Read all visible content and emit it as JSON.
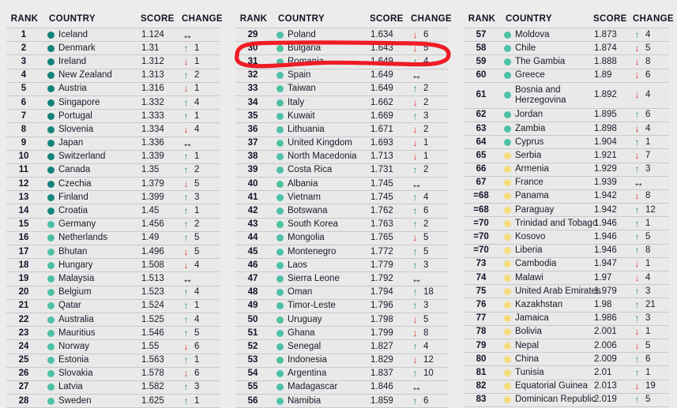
{
  "table": {
    "headers": {
      "rank": "RANK",
      "country": "COUNTRY",
      "score": "SCORE",
      "change": "CHANGE"
    },
    "colors": {
      "dot_dark_teal": "#14837a",
      "dot_teal": "#2fae96",
      "dot_light_teal": "#5ec6ad",
      "dot_yellow": "#f5dd7e",
      "arrow_up": "#2c8f6e",
      "arrow_down": "#e03127",
      "arrow_same": "#15151f",
      "annotation_red": "#ee1c25",
      "row_background": "#e9e9e9",
      "page_background": "#ececec"
    },
    "glyphs": {
      "up": "↑",
      "down": "↓",
      "same": "↔"
    },
    "columns": [
      {
        "id": "column-1",
        "rows": [
          {
            "rank": "1",
            "country": "Iceland",
            "score": "1.124",
            "dir": "same",
            "delta": "",
            "dot": "#14837a"
          },
          {
            "rank": "2",
            "country": "Denmark",
            "score": "1.31",
            "dir": "up",
            "delta": "1",
            "dot": "#14837a"
          },
          {
            "rank": "3",
            "country": "Ireland",
            "score": "1.312",
            "dir": "down",
            "delta": "1",
            "dot": "#14837a"
          },
          {
            "rank": "4",
            "country": "New Zealand",
            "score": "1.313",
            "dir": "up",
            "delta": "2",
            "dot": "#14837a"
          },
          {
            "rank": "5",
            "country": "Austria",
            "score": "1.316",
            "dir": "down",
            "delta": "1",
            "dot": "#14837a"
          },
          {
            "rank": "6",
            "country": "Singapore",
            "score": "1.332",
            "dir": "up",
            "delta": "4",
            "dot": "#14837a"
          },
          {
            "rank": "7",
            "country": "Portugal",
            "score": "1.333",
            "dir": "up",
            "delta": "1",
            "dot": "#14837a"
          },
          {
            "rank": "8",
            "country": "Slovenia",
            "score": "1.334",
            "dir": "down",
            "delta": "4",
            "dot": "#14837a"
          },
          {
            "rank": "9",
            "country": "Japan",
            "score": "1.336",
            "dir": "same",
            "delta": "",
            "dot": "#14837a"
          },
          {
            "rank": "10",
            "country": "Switzerland",
            "score": "1.339",
            "dir": "up",
            "delta": "1",
            "dot": "#14837a"
          },
          {
            "rank": "11",
            "country": "Canada",
            "score": "1.35",
            "dir": "up",
            "delta": "2",
            "dot": "#14837a"
          },
          {
            "rank": "12",
            "country": "Czechia",
            "score": "1.379",
            "dir": "down",
            "delta": "5",
            "dot": "#14837a"
          },
          {
            "rank": "13",
            "country": "Finland",
            "score": "1.399",
            "dir": "up",
            "delta": "3",
            "dot": "#16867c"
          },
          {
            "rank": "14",
            "country": "Croatia",
            "score": "1.45",
            "dir": "up",
            "delta": "1",
            "dot": "#17887d"
          },
          {
            "rank": "15",
            "country": "Germany",
            "score": "1.456",
            "dir": "up",
            "delta": "2",
            "dot": "#49bfa5"
          },
          {
            "rank": "16",
            "country": "Netherlands",
            "score": "1.49",
            "dir": "up",
            "delta": "5",
            "dot": "#4cc0a6"
          },
          {
            "rank": "17",
            "country": "Bhutan",
            "score": "1.496",
            "dir": "down",
            "delta": "5",
            "dot": "#4dc1a7"
          },
          {
            "rank": "18",
            "country": "Hungary",
            "score": "1.508",
            "dir": "down",
            "delta": "4",
            "dot": "#4dc1a7"
          },
          {
            "rank": "19",
            "country": "Malaysia",
            "score": "1.513",
            "dir": "same",
            "delta": "",
            "dot": "#4dc1a7"
          },
          {
            "rank": "20",
            "country": "Belgium",
            "score": "1.523",
            "dir": "up",
            "delta": "4",
            "dot": "#4dc1a7"
          },
          {
            "rank": "21",
            "country": "Qatar",
            "score": "1.524",
            "dir": "up",
            "delta": "1",
            "dot": "#4dc1a7"
          },
          {
            "rank": "22",
            "country": "Australia",
            "score": "1.525",
            "dir": "up",
            "delta": "4",
            "dot": "#4dc1a7"
          },
          {
            "rank": "23",
            "country": "Mauritius",
            "score": "1.546",
            "dir": "up",
            "delta": "5",
            "dot": "#4dc1a7"
          },
          {
            "rank": "24",
            "country": "Norway",
            "score": "1.55",
            "dir": "down",
            "delta": "6",
            "dot": "#4dc1a7"
          },
          {
            "rank": "25",
            "country": "Estonia",
            "score": "1.563",
            "dir": "up",
            "delta": "1",
            "dot": "#4dc1a7"
          },
          {
            "rank": "26",
            "country": "Slovakia",
            "score": "1.578",
            "dir": "down",
            "delta": "6",
            "dot": "#4dc1a7"
          },
          {
            "rank": "27",
            "country": "Latvia",
            "score": "1.582",
            "dir": "up",
            "delta": "3",
            "dot": "#4dc1a7"
          },
          {
            "rank": "28",
            "country": "Sweden",
            "score": "1.625",
            "dir": "up",
            "delta": "1",
            "dot": "#4dc1a7"
          }
        ]
      },
      {
        "id": "column-2",
        "rows": [
          {
            "rank": "29",
            "country": "Poland",
            "score": "1.634",
            "dir": "down",
            "delta": "6",
            "dot": "#4dc1a7"
          },
          {
            "rank": "30",
            "country": "Bulgaria",
            "score": "1.643",
            "dir": "down",
            "delta": "5",
            "dot": "#4dc1a7",
            "highlighted": true
          },
          {
            "rank": "31",
            "country": "Romania",
            "score": "1.649",
            "dir": "up",
            "delta": "4",
            "dot": "#4dc1a7"
          },
          {
            "rank": "32",
            "country": "Spain",
            "score": "1.649",
            "dir": "same",
            "delta": "",
            "dot": "#4dc1a7"
          },
          {
            "rank": "33",
            "country": "Taiwan",
            "score": "1.649",
            "dir": "up",
            "delta": "2",
            "dot": "#4dc1a7"
          },
          {
            "rank": "34",
            "country": "Italy",
            "score": "1.662",
            "dir": "down",
            "delta": "2",
            "dot": "#4dc1a7"
          },
          {
            "rank": "35",
            "country": "Kuwait",
            "score": "1.669",
            "dir": "up",
            "delta": "3",
            "dot": "#4dc1a7"
          },
          {
            "rank": "36",
            "country": "Lithuania",
            "score": "1.671",
            "dir": "down",
            "delta": "2",
            "dot": "#4dc1a7"
          },
          {
            "rank": "37",
            "country": "United Kingdom",
            "score": "1.693",
            "dir": "down",
            "delta": "1",
            "dot": "#4dc1a7"
          },
          {
            "rank": "38",
            "country": "North Macedonia",
            "score": "1.713",
            "dir": "down",
            "delta": "1",
            "dot": "#4dc1a7"
          },
          {
            "rank": "39",
            "country": "Costa Rica",
            "score": "1.731",
            "dir": "up",
            "delta": "2",
            "dot": "#4dc1a7"
          },
          {
            "rank": "40",
            "country": "Albania",
            "score": "1.745",
            "dir": "same",
            "delta": "",
            "dot": "#4dc1a7"
          },
          {
            "rank": "41",
            "country": "Vietnam",
            "score": "1.745",
            "dir": "up",
            "delta": "4",
            "dot": "#4dc1a7"
          },
          {
            "rank": "42",
            "country": "Botswana",
            "score": "1.762",
            "dir": "up",
            "delta": "6",
            "dot": "#4dc1a7"
          },
          {
            "rank": "43",
            "country": "South Korea",
            "score": "1.763",
            "dir": "up",
            "delta": "2",
            "dot": "#4dc1a7"
          },
          {
            "rank": "44",
            "country": "Mongolia",
            "score": "1.765",
            "dir": "down",
            "delta": "5",
            "dot": "#4dc1a7"
          },
          {
            "rank": "45",
            "country": "Montenegro",
            "score": "1.772",
            "dir": "up",
            "delta": "5",
            "dot": "#4dc1a7"
          },
          {
            "rank": "46",
            "country": "Laos",
            "score": "1.779",
            "dir": "up",
            "delta": "3",
            "dot": "#4dc1a7"
          },
          {
            "rank": "47",
            "country": "Sierra Leone",
            "score": "1.792",
            "dir": "same",
            "delta": "",
            "dot": "#4dc1a7"
          },
          {
            "rank": "48",
            "country": "Oman",
            "score": "1.794",
            "dir": "up",
            "delta": "18",
            "dot": "#4dc1a7"
          },
          {
            "rank": "49",
            "country": "Timor-Leste",
            "score": "1.796",
            "dir": "up",
            "delta": "3",
            "dot": "#4dc1a7"
          },
          {
            "rank": "50",
            "country": "Uruguay",
            "score": "1.798",
            "dir": "down",
            "delta": "5",
            "dot": "#4dc1a7"
          },
          {
            "rank": "51",
            "country": "Ghana",
            "score": "1.799",
            "dir": "down",
            "delta": "8",
            "dot": "#4dc1a7"
          },
          {
            "rank": "52",
            "country": "Senegal",
            "score": "1.827",
            "dir": "up",
            "delta": "4",
            "dot": "#4dc1a7"
          },
          {
            "rank": "53",
            "country": "Indonesia",
            "score": "1.829",
            "dir": "down",
            "delta": "12",
            "dot": "#4dc1a7"
          },
          {
            "rank": "54",
            "country": "Argentina",
            "score": "1.837",
            "dir": "up",
            "delta": "10",
            "dot": "#4dc1a7"
          },
          {
            "rank": "55",
            "country": "Madagascar",
            "score": "1.846",
            "dir": "same",
            "delta": "",
            "dot": "#4dc1a7"
          },
          {
            "rank": "56",
            "country": "Namibia",
            "score": "1.859",
            "dir": "up",
            "delta": "6",
            "dot": "#4dc1a7"
          }
        ]
      },
      {
        "id": "column-3",
        "rows": [
          {
            "rank": "57",
            "country": "Moldova",
            "score": "1.873",
            "dir": "up",
            "delta": "4",
            "dot": "#4dc1a7"
          },
          {
            "rank": "58",
            "country": "Chile",
            "score": "1.874",
            "dir": "down",
            "delta": "5",
            "dot": "#4dc1a7"
          },
          {
            "rank": "59",
            "country": "The Gambia",
            "score": "1.888",
            "dir": "down",
            "delta": "8",
            "dot": "#4dc1a7"
          },
          {
            "rank": "60",
            "country": "Greece",
            "score": "1.89",
            "dir": "down",
            "delta": "6",
            "dot": "#4dc1a7"
          },
          {
            "rank": "61",
            "country": "Bosnia and Herzegovina",
            "score": "1.892",
            "dir": "down",
            "delta": "4",
            "dot": "#4dc1a7",
            "tall": true
          },
          {
            "rank": "62",
            "country": "Jordan",
            "score": "1.895",
            "dir": "up",
            "delta": "6",
            "dot": "#4dc1a7"
          },
          {
            "rank": "63",
            "country": "Zambia",
            "score": "1.898",
            "dir": "down",
            "delta": "4",
            "dot": "#4dc1a7"
          },
          {
            "rank": "64",
            "country": "Cyprus",
            "score": "1.904",
            "dir": "up",
            "delta": "1",
            "dot": "#4dc1a7"
          },
          {
            "rank": "65",
            "country": "Serbia",
            "score": "1.921",
            "dir": "down",
            "delta": "7",
            "dot": "#f5dd7e"
          },
          {
            "rank": "66",
            "country": "Armenia",
            "score": "1.929",
            "dir": "up",
            "delta": "3",
            "dot": "#f5dd7e"
          },
          {
            "rank": "67",
            "country": "France",
            "score": "1.939",
            "dir": "same",
            "delta": "",
            "dot": "#f5dd7e"
          },
          {
            "rank": "=68",
            "country": "Panama",
            "score": "1.942",
            "dir": "down",
            "delta": "8",
            "dot": "#f5dd7e"
          },
          {
            "rank": "=68",
            "country": "Paraguay",
            "score": "1.942",
            "dir": "up",
            "delta": "12",
            "dot": "#f5dd7e"
          },
          {
            "rank": "=70",
            "country": "Trinidad and Tobago",
            "score": "1.946",
            "dir": "up",
            "delta": "1",
            "dot": "#f5dd7e"
          },
          {
            "rank": "=70",
            "country": "Kosovo",
            "score": "1.946",
            "dir": "up",
            "delta": "5",
            "dot": "#f5dd7e"
          },
          {
            "rank": "=70",
            "country": "Liberia",
            "score": "1.946",
            "dir": "up",
            "delta": "8",
            "dot": "#f5dd7e"
          },
          {
            "rank": "73",
            "country": "Cambodia",
            "score": "1.947",
            "dir": "down",
            "delta": "1",
            "dot": "#f5dd7e"
          },
          {
            "rank": "74",
            "country": "Malawi",
            "score": "1.97",
            "dir": "down",
            "delta": "4",
            "dot": "#f5dd7e"
          },
          {
            "rank": "75",
            "country": "United Arab Emirates",
            "score": "1.979",
            "dir": "up",
            "delta": "3",
            "dot": "#f5dd7e"
          },
          {
            "rank": "76",
            "country": "Kazakhstan",
            "score": "1.98",
            "dir": "up",
            "delta": "21",
            "dot": "#f5dd7e"
          },
          {
            "rank": "77",
            "country": "Jamaica",
            "score": "1.986",
            "dir": "up",
            "delta": "3",
            "dot": "#f5dd7e"
          },
          {
            "rank": "78",
            "country": "Bolivia",
            "score": "2.001",
            "dir": "down",
            "delta": "1",
            "dot": "#f5dd7e"
          },
          {
            "rank": "79",
            "country": "Nepal",
            "score": "2.006",
            "dir": "down",
            "delta": "5",
            "dot": "#f5dd7e"
          },
          {
            "rank": "80",
            "country": "China",
            "score": "2.009",
            "dir": "up",
            "delta": "6",
            "dot": "#f5dd7e"
          },
          {
            "rank": "81",
            "country": "Tunisia",
            "score": "2.01",
            "dir": "up",
            "delta": "1",
            "dot": "#f5dd7e"
          },
          {
            "rank": "82",
            "country": "Equatorial Guinea",
            "score": "2.013",
            "dir": "down",
            "delta": "19",
            "dot": "#f5dd7e"
          },
          {
            "rank": "83",
            "country": "Dominican Republic",
            "score": "2.019",
            "dir": "up",
            "delta": "5",
            "dot": "#f5dd7e"
          }
        ]
      }
    ]
  },
  "annotation": {
    "type": "hand-drawn-ellipse",
    "color": "#ee1c25",
    "targets_row_rank": "30",
    "targets_row_country": "Bulgaria"
  }
}
